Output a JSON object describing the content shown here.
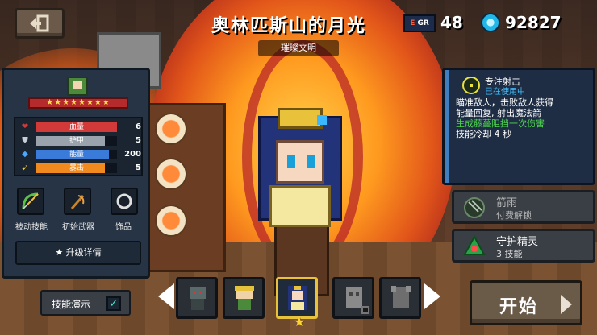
{
  "header": {
    "back_icon": "exit-door-icon",
    "title": "奥林匹斯山的月光",
    "subtitle": "璀璨文明",
    "energy_badge": "E",
    "energy_badge_sub": "GR",
    "energy_value": "48",
    "gem_value": "92827"
  },
  "stats": {
    "stars": "★★★★★★★★",
    "rows": [
      {
        "icon": "heart-icon",
        "label": "血量",
        "value": "6",
        "color": "#d23a3a",
        "fill": 1.0
      },
      {
        "icon": "shield-icon",
        "label": "护甲",
        "value": "5",
        "color": "#9aa3ad",
        "fill": 0.85
      },
      {
        "icon": "energy-crystal-icon",
        "label": "能量",
        "value": "200",
        "color": "#3a7ad8",
        "fill": 0.9
      },
      {
        "icon": "crit-icon",
        "label": "暴击",
        "value": "5",
        "color": "#f08a1e",
        "fill": 0.85
      }
    ],
    "slots": [
      {
        "icon": "bow-icon",
        "label": "被动技能"
      },
      {
        "icon": "starter-weapon-icon",
        "label": "初始武器"
      },
      {
        "icon": "ring-icon",
        "label": "饰品"
      }
    ],
    "upgrade_label": "★ 升级详情"
  },
  "skill": {
    "name": "专注射击",
    "status": "已在使用中",
    "desc_line1": "瞄准敌人，击败敌人获得",
    "desc_line2": "能量回复, 射出魔法箭",
    "desc_line3": "生成藤蔓阻挡一次伤害",
    "desc_line4": "技能冷却 4 秒"
  },
  "alt_skills": [
    {
      "icon": "arrow-rain-icon",
      "name": "箭雨",
      "sub": "付费解锁",
      "locked": true
    },
    {
      "icon": "guardian-spirit-icon",
      "name": "守护精灵",
      "sub": "3 技能",
      "locked": false
    }
  ],
  "bottom": {
    "demo_label": "技能演示",
    "demo_checked": "✓",
    "start_label": "开始",
    "selected_star": "★"
  },
  "colors": {
    "accent_gold": "#e8c23a",
    "skill_blue": "#3fc0ff",
    "skill_green": "#4cd64c"
  }
}
